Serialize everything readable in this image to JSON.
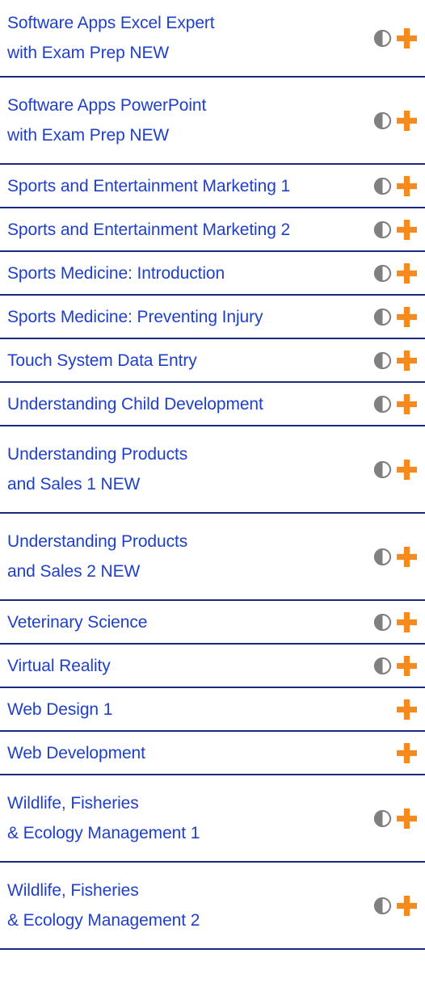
{
  "colors": {
    "title": "#1f40c8",
    "divider": "#1a2a7c",
    "plus": "#f58a1f",
    "half_circle": "#808080"
  },
  "courses": [
    {
      "lines": [
        "Software Apps Excel Expert",
        "with Exam Prep NEW"
      ],
      "icons": [
        "half-circle-icon",
        "plus-icon"
      ]
    },
    {
      "lines": [
        "Software Apps PowerPoint",
        "with Exam Prep NEW"
      ],
      "icons": [
        "half-circle-icon",
        "plus-icon"
      ]
    },
    {
      "lines": [
        "Sports and Entertainment Marketing 1"
      ],
      "icons": [
        "half-circle-icon",
        "plus-icon"
      ]
    },
    {
      "lines": [
        "Sports and Entertainment Marketing 2"
      ],
      "icons": [
        "half-circle-icon",
        "plus-icon"
      ]
    },
    {
      "lines": [
        "Sports Medicine: Introduction"
      ],
      "icons": [
        "half-circle-icon",
        "plus-icon"
      ]
    },
    {
      "lines": [
        "Sports Medicine: Preventing Injury"
      ],
      "icons": [
        "half-circle-icon",
        "plus-icon"
      ]
    },
    {
      "lines": [
        "Touch System Data Entry"
      ],
      "icons": [
        "half-circle-icon",
        "plus-icon"
      ]
    },
    {
      "lines": [
        "Understanding Child Development"
      ],
      "icons": [
        "half-circle-icon",
        "plus-icon"
      ]
    },
    {
      "lines": [
        "Understanding Products",
        "and Sales 1 NEW"
      ],
      "icons": [
        "half-circle-icon",
        "plus-icon"
      ]
    },
    {
      "lines": [
        "Understanding Products",
        "and Sales 2 NEW"
      ],
      "icons": [
        "half-circle-icon",
        "plus-icon"
      ]
    },
    {
      "lines": [
        "Veterinary Science"
      ],
      "icons": [
        "half-circle-icon",
        "plus-icon"
      ]
    },
    {
      "lines": [
        "Virtual Reality"
      ],
      "icons": [
        "half-circle-icon",
        "plus-icon"
      ]
    },
    {
      "lines": [
        "Web Design 1"
      ],
      "icons": [
        "plus-icon"
      ]
    },
    {
      "lines": [
        "Web Development"
      ],
      "icons": [
        "plus-icon"
      ]
    },
    {
      "lines": [
        "Wildlife, Fisheries",
        "& Ecology Management 1"
      ],
      "icons": [
        "half-circle-icon",
        "plus-icon"
      ]
    },
    {
      "lines": [
        "Wildlife, Fisheries",
        "& Ecology Management 2"
      ],
      "icons": [
        "half-circle-icon",
        "plus-icon"
      ]
    }
  ]
}
